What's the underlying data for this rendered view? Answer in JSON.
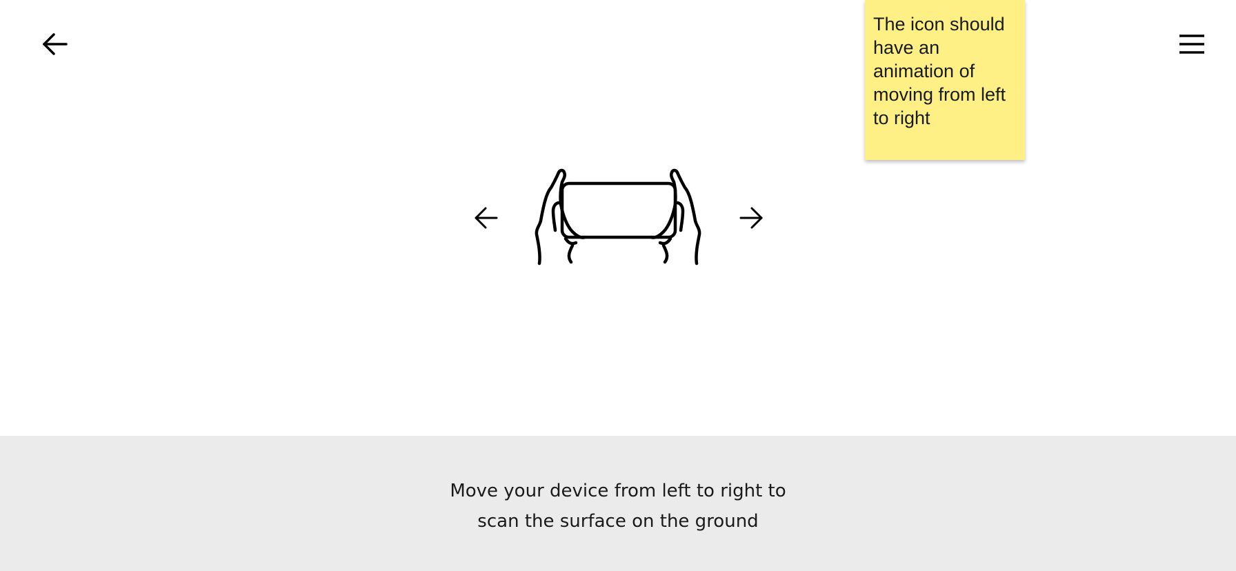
{
  "header": {
    "back_icon": "arrow-left-icon",
    "menu_icon": "hamburger-menu-icon"
  },
  "annotation": {
    "note_text": "The icon should have an animation of moving from left to right",
    "note_color": "#fef084"
  },
  "illustration": {
    "left_icon": "arrow-left-icon",
    "device_icon": "hands-holding-phone-icon",
    "right_icon": "arrow-right-icon"
  },
  "instruction": {
    "line1": "Move your device from left to right to",
    "line2": "scan the surface on the ground",
    "panel_color": "#ebebeb"
  }
}
